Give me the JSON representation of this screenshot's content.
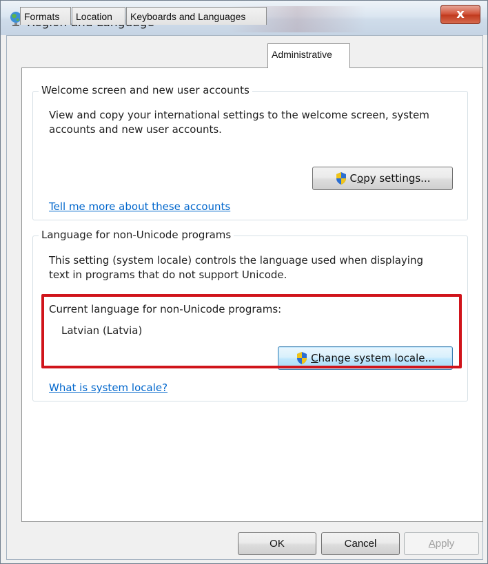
{
  "window": {
    "title": "Region and Language",
    "close_symbol": "x"
  },
  "tabs": [
    {
      "label": "Formats"
    },
    {
      "label": "Location"
    },
    {
      "label": "Keyboards and Languages"
    },
    {
      "label": "Administrative",
      "active": true
    }
  ],
  "welcome": {
    "title": "Welcome screen and new user accounts",
    "description_line1": "View and copy your international settings to the welcome screen, system",
    "description_line2": "accounts and new user accounts.",
    "button_pre": "C",
    "button_access": "o",
    "button_post": "py settings...",
    "link": "Tell me more about these accounts"
  },
  "nonunicode": {
    "title": "Language for non-Unicode programs",
    "description_line1": "This setting (system locale) controls the language used when displaying",
    "description_line2": "text in programs that do not support Unicode.",
    "current_label": "Current language for non-Unicode programs:",
    "current_value": "Latvian (Latvia)",
    "button_access": "C",
    "button_post": "hange system locale...",
    "link": "What is system locale?"
  },
  "footer": {
    "ok": "OK",
    "cancel": "Cancel",
    "apply_access": "A",
    "apply_post": "pply"
  },
  "colors": {
    "highlight": "#d0141b",
    "link": "#0066cc",
    "close": "#c13b1f"
  }
}
